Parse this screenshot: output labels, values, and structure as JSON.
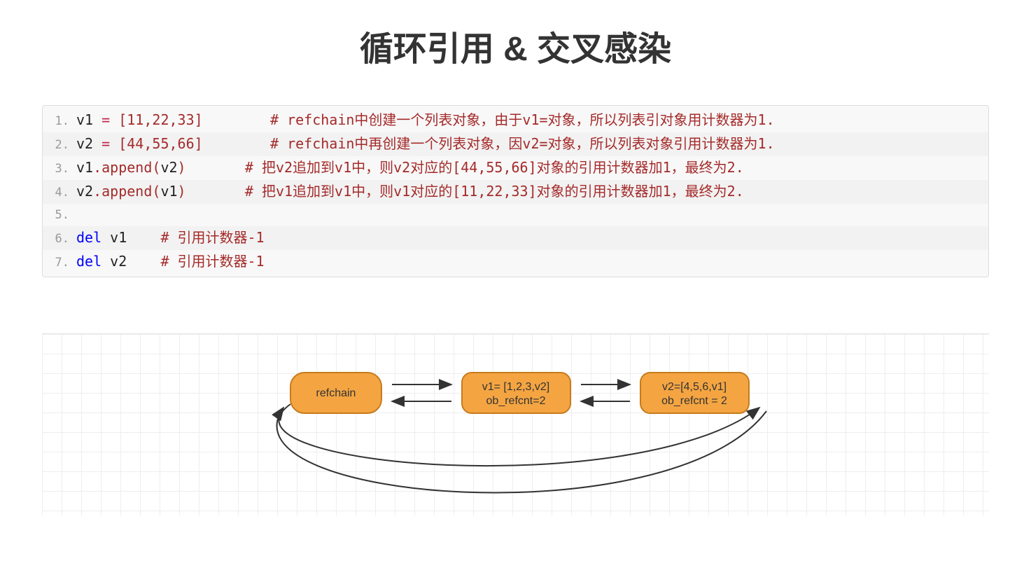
{
  "title": "循环引用 & 交叉感染",
  "code": {
    "lines": [
      {
        "no": "1.",
        "tokens": [
          [
            "v",
            "v1 "
          ],
          [
            "op",
            "= "
          ],
          [
            "punc",
            "["
          ],
          [
            "num",
            "11"
          ],
          [
            "punc",
            ","
          ],
          [
            "num",
            "22"
          ],
          [
            "punc",
            ","
          ],
          [
            "num",
            "33"
          ],
          [
            "punc",
            "]"
          ],
          [
            "sp",
            "        "
          ],
          [
            "cmt",
            "# refchain中创建一个列表对象，由于v1=对象，所以列表引对象用计数器为1."
          ]
        ]
      },
      {
        "no": "2.",
        "tokens": [
          [
            "v",
            "v2 "
          ],
          [
            "op",
            "= "
          ],
          [
            "punc",
            "["
          ],
          [
            "num",
            "44"
          ],
          [
            "punc",
            ","
          ],
          [
            "num",
            "55"
          ],
          [
            "punc",
            ","
          ],
          [
            "num",
            "66"
          ],
          [
            "punc",
            "]"
          ],
          [
            "sp",
            "        "
          ],
          [
            "cmt",
            "# refchain中再创建一个列表对象，因v2=对象，所以列表对象引用计数器为1."
          ]
        ]
      },
      {
        "no": "3.",
        "tokens": [
          [
            "v",
            "v1"
          ],
          [
            "punc",
            "."
          ],
          [
            "call",
            "append"
          ],
          [
            "punc",
            "("
          ],
          [
            "id",
            "v2"
          ],
          [
            "punc",
            ")"
          ],
          [
            "sp",
            "       "
          ],
          [
            "cmt",
            "# 把v2追加到v1中，则v2对应的[44,55,66]对象的引用计数器加1，最终为2."
          ]
        ]
      },
      {
        "no": "4.",
        "tokens": [
          [
            "v",
            "v2"
          ],
          [
            "punc",
            "."
          ],
          [
            "call",
            "append"
          ],
          [
            "punc",
            "("
          ],
          [
            "id",
            "v1"
          ],
          [
            "punc",
            ")"
          ],
          [
            "sp",
            "       "
          ],
          [
            "cmt",
            "# 把v1追加到v1中，则v1对应的[11,22,33]对象的引用计数器加1，最终为2."
          ]
        ]
      },
      {
        "no": "5.",
        "tokens": []
      },
      {
        "no": "6.",
        "tokens": [
          [
            "kw",
            "del"
          ],
          [
            "sp",
            " "
          ],
          [
            "id",
            "v1"
          ],
          [
            "sp",
            "    "
          ],
          [
            "cmt",
            "# 引用计数器-1"
          ]
        ]
      },
      {
        "no": "7.",
        "tokens": [
          [
            "kw",
            "del"
          ],
          [
            "sp",
            " "
          ],
          [
            "id",
            "v2"
          ],
          [
            "sp",
            "    "
          ],
          [
            "cmt",
            "# 引用计数器-1"
          ]
        ]
      }
    ]
  },
  "diagram": {
    "nodes": {
      "refchain": {
        "label": "refchain"
      },
      "v1": {
        "line1": "v1= [1,2,3,v2]",
        "line2": "ob_refcnt=2"
      },
      "v2": {
        "line1": "v2=[4,5,6,v1]",
        "line2": "ob_refcnt = 2"
      }
    }
  }
}
